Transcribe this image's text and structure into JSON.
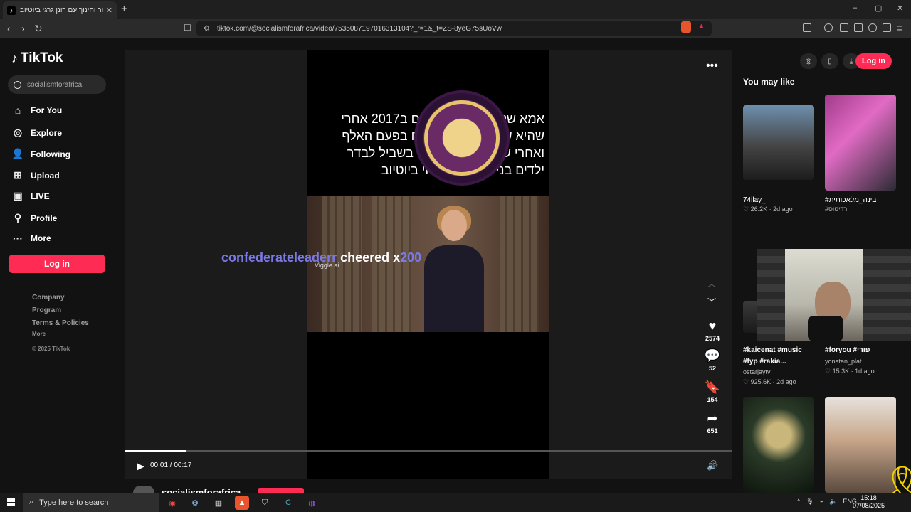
{
  "browser": {
    "tab_title": "הומור וחינוך עם רונן גרגי ביוטיוב |",
    "new_tab": "+",
    "url": "tiktok.com/@socialismforafrica/video/7535087197016313104?_r=1&_t=ZS-8yeG75sUoVw",
    "win_min": "–",
    "win_max": "▢",
    "win_close": "✕"
  },
  "sidebar": {
    "logo": "TikTok",
    "search_text": "socialismforafrica",
    "items": [
      {
        "label": "For You",
        "icon": "home-icon"
      },
      {
        "label": "Explore",
        "icon": "compass-icon"
      },
      {
        "label": "Following",
        "icon": "following-icon"
      },
      {
        "label": "Upload",
        "icon": "upload-icon"
      },
      {
        "label": "LIVE",
        "icon": "live-icon"
      },
      {
        "label": "Profile",
        "icon": "profile-icon"
      },
      {
        "label": "More",
        "icon": "more-icon"
      }
    ],
    "login": "Log in",
    "footer": [
      "Company",
      "Program",
      "Terms & Policies",
      "More",
      "© 2025 TikTok"
    ]
  },
  "video": {
    "overlay_lines": [
      "אמא של רונן גרגי מת שם ב2017 אחרי",
      "שהיא שתתה לשוחט ברח בפעם האלף",
      "ואחרי שהיא נשארה לבד בשביל לבדר",
      "ילדים בני 12 בשידור חי ביוטיוב"
    ],
    "watermark": "Viggle.ai",
    "cheer_user": "confederateleaderr",
    "cheer_text": " cheered x",
    "cheer_amount": "200",
    "likes": "2574",
    "comments": "52",
    "saves": "154",
    "shares": "651",
    "time": "00:01 / 00:17",
    "progress": 0.1,
    "author": "socialismforafrica"
  },
  "rail": {
    "login": "Log in",
    "heading": "You may like",
    "items": [
      {
        "caption": "74ilay_",
        "meta": "♡ 26.2K · 2d ago"
      },
      {
        "caption": "#בינה_מלאכותית",
        "meta": "#רדיטוס"
      },
      {
        "caption": "#kaicenat #music",
        "caption2": "#fyp #rakia...",
        "user": "ostarjaytv",
        "meta": "♡ 925.6K · 2d ago"
      },
      {
        "caption": "#foryou #פורי",
        "user": "yonatan_plat",
        "meta": "♡ 15.3K · 1d ago"
      }
    ]
  },
  "taskbar": {
    "search_placeholder": "Type here to search",
    "lang": "ENG",
    "time": "15:18",
    "date": "07/08/2025"
  },
  "colors": {
    "accent": "#fe2c55",
    "cheer": "#7b79e6"
  }
}
